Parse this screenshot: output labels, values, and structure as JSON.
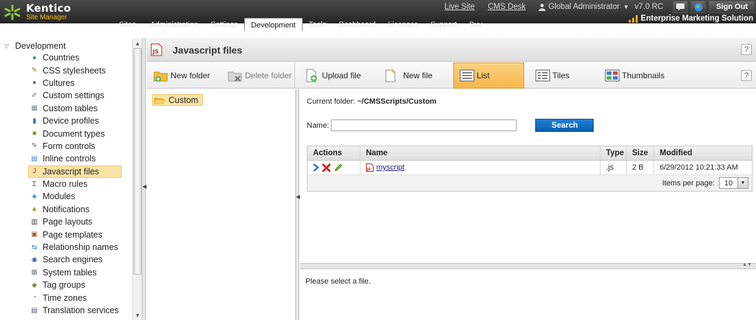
{
  "header": {
    "brand": "Kentico",
    "subtitle": "Site Manager",
    "links": {
      "live_site": "Live Site",
      "cms_desk": "CMS Desk"
    },
    "user": "Global Administrator",
    "version": "v7.0 RC",
    "sign_out": "Sign Out",
    "edition": "Enterprise Marketing Solution",
    "nav": [
      "Sites",
      "Administration",
      "Settings",
      "Development",
      "Tools",
      "Dashboard",
      "Licenses",
      "Support",
      "Buy"
    ],
    "active_nav": "Development"
  },
  "tree": {
    "root": "Development",
    "items": [
      {
        "label": "Countries",
        "icon": "globe-icon"
      },
      {
        "label": "CSS stylesheets",
        "icon": "brush-icon"
      },
      {
        "label": "Cultures",
        "icon": "globe-icon"
      },
      {
        "label": "Custom settings",
        "icon": "wrench-icon"
      },
      {
        "label": "Custom tables",
        "icon": "table-icon"
      },
      {
        "label": "Device profiles",
        "icon": "device-icon"
      },
      {
        "label": "Document types",
        "icon": "document-type-icon"
      },
      {
        "label": "Form controls",
        "icon": "form-icon"
      },
      {
        "label": "Inline controls",
        "icon": "inline-control-icon"
      },
      {
        "label": "Javascript files",
        "icon": "js-file-icon"
      },
      {
        "label": "Macro rules",
        "icon": "macro-icon"
      },
      {
        "label": "Modules",
        "icon": "modules-icon"
      },
      {
        "label": "Notifications",
        "icon": "notification-icon"
      },
      {
        "label": "Page layouts",
        "icon": "layout-icon"
      },
      {
        "label": "Page templates",
        "icon": "template-icon"
      },
      {
        "label": "Relationship names",
        "icon": "relationship-icon"
      },
      {
        "label": "Search engines",
        "icon": "search-engine-icon"
      },
      {
        "label": "System tables",
        "icon": "table-icon"
      },
      {
        "label": "Tag groups",
        "icon": "tag-icon"
      },
      {
        "label": "Time zones",
        "icon": "clock-icon"
      },
      {
        "label": "Translation services",
        "icon": "translation-icon"
      }
    ],
    "selected": "Javascript files"
  },
  "page": {
    "title": "Javascript files",
    "help": "?"
  },
  "toolbar": {
    "new_folder": "New folder",
    "delete_folder": "Delete folder",
    "upload_file": "Upload file",
    "new_file": "New file",
    "view_list": "List",
    "view_tiles": "Tiles",
    "view_thumbnails": "Thumbnails",
    "active_view": "List"
  },
  "folders": {
    "current": "Custom"
  },
  "content": {
    "current_folder_label": "Current folder:",
    "current_folder_path": "~/CMSScripts/Custom",
    "name_label": "Name:",
    "name_value": "",
    "search_button": "Search",
    "columns": [
      "Actions",
      "Name",
      "Type",
      "Size",
      "Modified"
    ],
    "rows": [
      {
        "name": "myscript",
        "type": ".js",
        "size": "2 B",
        "modified": "6/29/2012 10:21:33 AM"
      }
    ],
    "items_per_page_label": "Items per page:",
    "items_per_page": "10",
    "preview_message": "Please select a file."
  },
  "colors": {
    "header_bg": "#333333",
    "selected_bg": "#fbe3a7",
    "active_button": "#f7b64c",
    "search_button": "#0b5fad",
    "logo_green": "#8cc63f"
  }
}
